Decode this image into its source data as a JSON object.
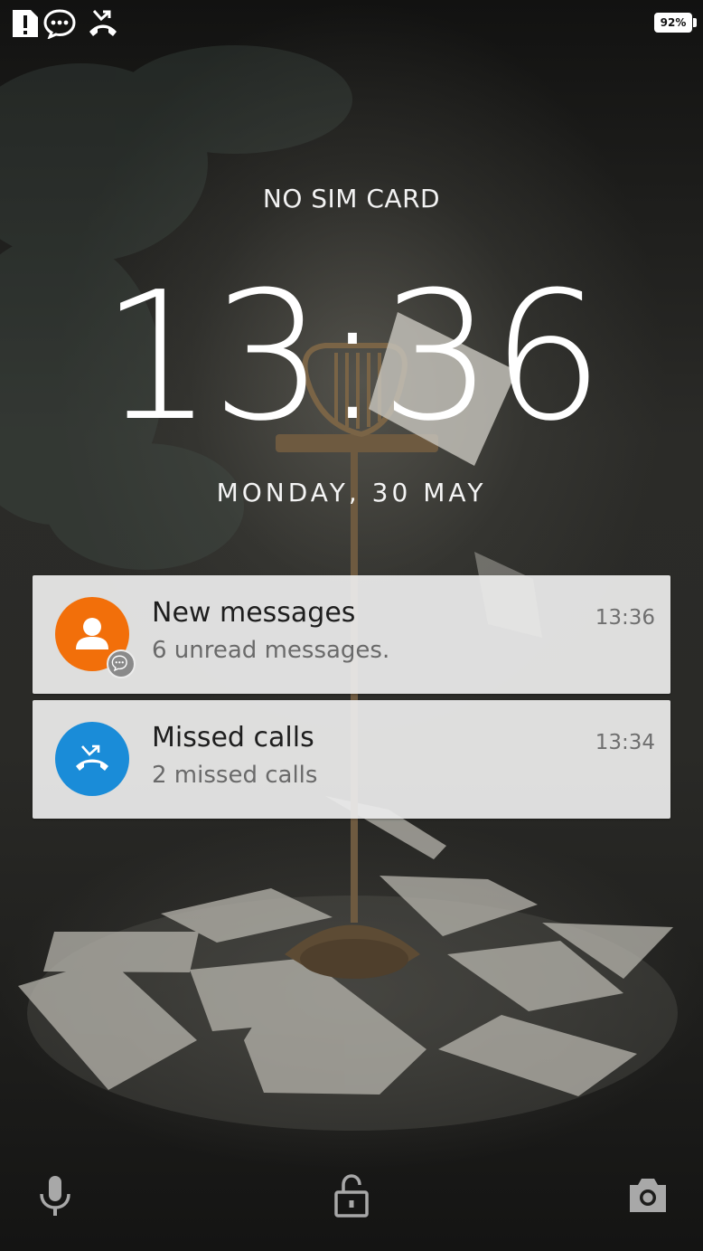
{
  "status_bar": {
    "icons": [
      "sim-alert-icon",
      "message-icon",
      "missed-call-icon"
    ],
    "battery_level": "92%"
  },
  "lockscreen": {
    "carrier": "NO SIM CARD",
    "time": "13:36",
    "date": "MONDAY, 30 MAY"
  },
  "notifications": [
    {
      "title": "New messages",
      "subtitle": "6 unread messages.",
      "time": "13:36",
      "icon": "contact-icon",
      "color": "#F26F0A",
      "badge_icon": "message-badge-icon"
    },
    {
      "title": "Missed calls",
      "subtitle": "2 missed calls",
      "time": "13:34",
      "icon": "missed-call-icon",
      "color": "#1A8CD8"
    }
  ],
  "bottom_bar": {
    "left_icon": "microphone-icon",
    "center_icon": "unlock-icon",
    "right_icon": "camera-icon"
  }
}
